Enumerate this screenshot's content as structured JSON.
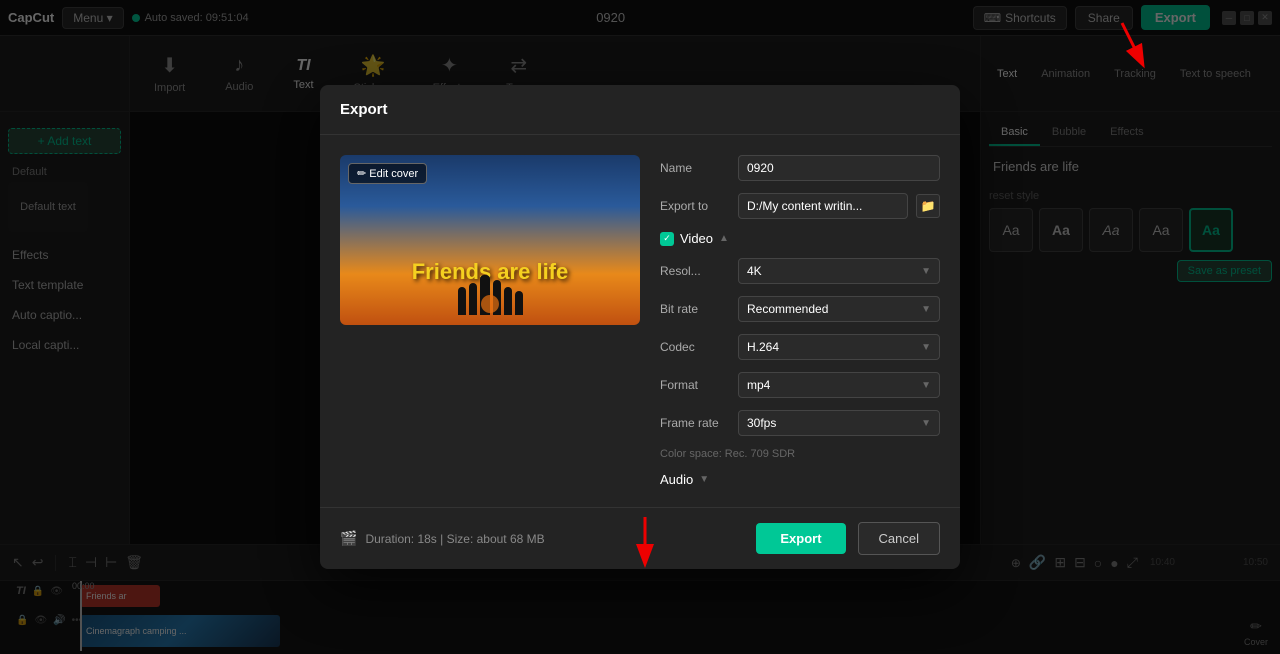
{
  "app": {
    "logo": "CapCut",
    "menu_label": "Menu ▾",
    "autosave_text": "Auto saved: 09:51:04",
    "title": "0920",
    "shortcuts_label": "Shortcuts",
    "share_label": "Share",
    "export_label": "Export"
  },
  "toolbar": {
    "items": [
      {
        "id": "import",
        "icon": "⬇",
        "label": "Import"
      },
      {
        "id": "audio",
        "icon": "♪",
        "label": "Audio"
      },
      {
        "id": "text",
        "icon": "TI",
        "label": "Text",
        "active": true
      },
      {
        "id": "stickers",
        "icon": "★",
        "label": "Stickers"
      },
      {
        "id": "effects",
        "icon": "✦",
        "label": "Effects"
      },
      {
        "id": "transitions",
        "icon": "⇄",
        "label": "Tra..."
      }
    ]
  },
  "right_toolbar": {
    "tabs": [
      "Text",
      "Animation",
      "Tracking",
      "Text to speech"
    ],
    "active_tab": "Text"
  },
  "left_sidebar": {
    "add_text": "+ Add text",
    "section_label": "Default",
    "nav_items": [
      "Effects",
      "Text template",
      "Auto captio...",
      "Local capti..."
    ]
  },
  "right_panel": {
    "tabs": [
      "Basic",
      "Bubble",
      "Effects"
    ],
    "active_tab": "Basic",
    "text_preview": "Friends are life",
    "section_label": "reset style",
    "save_preset_label": "Save as preset",
    "style_items": [
      "Aa",
      "Aa",
      "Aa",
      "Aa",
      "Aa"
    ]
  },
  "export_modal": {
    "title": "Export",
    "thumbnail_title": "Friends are life",
    "edit_cover_label": "✏ Edit cover",
    "fields": {
      "name": {
        "label": "Name",
        "value": "0920"
      },
      "export_to": {
        "label": "Export to",
        "value": "D:/My content writin..."
      },
      "video_section": "Video",
      "resolution": {
        "label": "Resol...",
        "value": "4K"
      },
      "bit_rate": {
        "label": "Bit rate",
        "value": "Recommended"
      },
      "codec": {
        "label": "Codec",
        "value": "H.264"
      },
      "format": {
        "label": "Format",
        "value": "mp4"
      },
      "frame_rate": {
        "label": "Frame rate",
        "value": "30fps"
      },
      "color_space": "Color space: Rec. 709 SDR",
      "audio_section": "Audio"
    },
    "footer": {
      "duration": "Duration: 18s | Size: about 68 MB",
      "export_btn": "Export",
      "cancel_btn": "Cancel"
    }
  },
  "timeline": {
    "clips": [
      {
        "type": "text",
        "label": "Friends ar",
        "color": "#c0392b"
      },
      {
        "type": "video",
        "label": "Cinemagraph camping ...",
        "color": "#2980b9"
      }
    ],
    "timecodes": [
      "00:00",
      "10:40",
      "10:50"
    ]
  }
}
